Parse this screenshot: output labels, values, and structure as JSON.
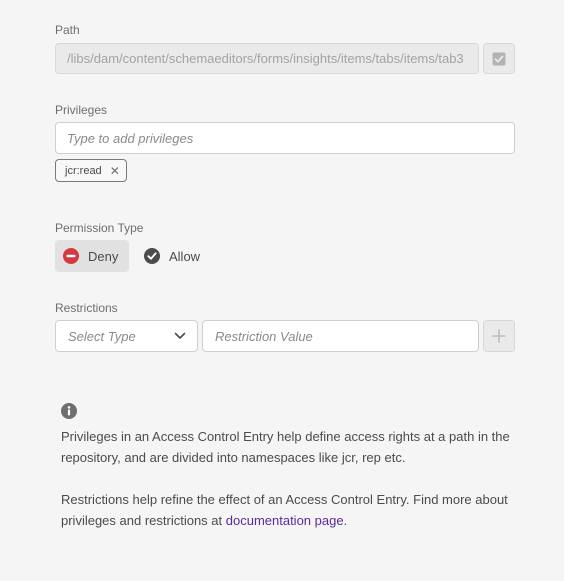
{
  "path": {
    "label": "Path",
    "value": "/libs/dam/content/schemaeditors/forms/insights/items/tabs/items/tab3"
  },
  "privileges": {
    "label": "Privileges",
    "placeholder": "Type to add privileges",
    "tags": [
      "jcr:read"
    ]
  },
  "permission": {
    "label": "Permission Type",
    "options": [
      "Deny",
      "Allow"
    ],
    "selected": "Deny"
  },
  "restrictions": {
    "label": "Restrictions",
    "type_placeholder": "Select Type",
    "value_placeholder": "Restriction Value"
  },
  "info": {
    "paragraph1": "Privileges in an Access Control Entry help define access rights at a path in the repository, and are divided into namespaces like jcr, rep etc.",
    "paragraph2_prefix": "Restrictions help refine the effect of an Access Control Entry. Find more about privileges and restrictions at ",
    "link_text": "documentation page",
    "paragraph2_suffix": "."
  },
  "colors": {
    "deny_icon": "#d7373f",
    "allow_icon": "#4b4b4b",
    "link": "#5b2a9c"
  }
}
